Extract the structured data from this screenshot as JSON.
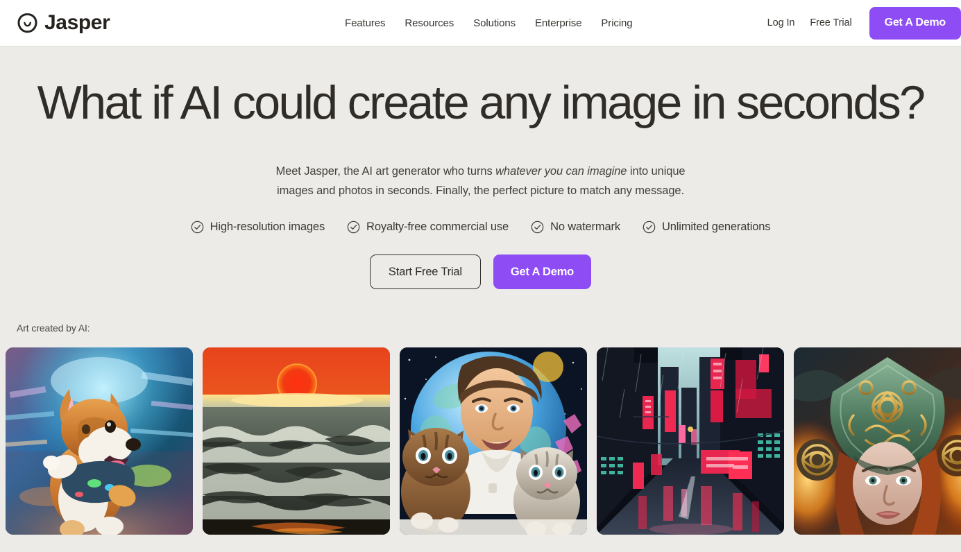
{
  "header": {
    "brand": {
      "name": "Jasper",
      "logo_icon": "jasper-smiley-logo"
    },
    "nav": [
      {
        "label": "Features"
      },
      {
        "label": "Resources"
      },
      {
        "label": "Solutions"
      },
      {
        "label": "Enterprise"
      },
      {
        "label": "Pricing"
      }
    ],
    "login_label": "Log In",
    "free_trial_label": "Free Trial",
    "demo_button_label": "Get A Demo",
    "accent_color": "#8E4CF5",
    "background_color": "#FFFFFF"
  },
  "hero": {
    "headline": "What if AI could create any image in seconds?",
    "sub_part1": "Meet Jasper, the AI art generator who turns ",
    "sub_emphasis": "whatever you can imagine",
    "sub_part2": " into unique images and photos in seconds. Finally, the perfect picture to match any message.",
    "features": [
      {
        "label": "High-resolution images",
        "icon": "check-circle-icon"
      },
      {
        "label": "Royalty-free commercial use",
        "icon": "check-circle-icon"
      },
      {
        "label": "No watermark",
        "icon": "check-circle-icon"
      },
      {
        "label": "Unlimited generations",
        "icon": "check-circle-icon"
      }
    ],
    "cta_primary_label": "Start Free Trial",
    "cta_secondary_label": "Get A Demo",
    "gallery_label": "Art created by AI:",
    "background_color": "#EDEBE7",
    "text_color": "#302D28"
  },
  "gallery": {
    "items": [
      {
        "name": "running-corgi-neon-city",
        "alt": "Corgi dog running through a neon-lit city with motion blur"
      },
      {
        "name": "red-sun-ocean-waves",
        "alt": "Red sun setting over stormy ocean waves"
      },
      {
        "name": "man-with-two-kittens-space",
        "alt": "Smiling man holding two kittens in front of a blue planet"
      },
      {
        "name": "cyberpunk-rainy-street",
        "alt": "Rainy cyberpunk street with pink and red neon signs"
      },
      {
        "name": "celtic-warrior-woman",
        "alt": "Warrior woman wearing an ornate Celtic knotwork helmet"
      }
    ]
  }
}
